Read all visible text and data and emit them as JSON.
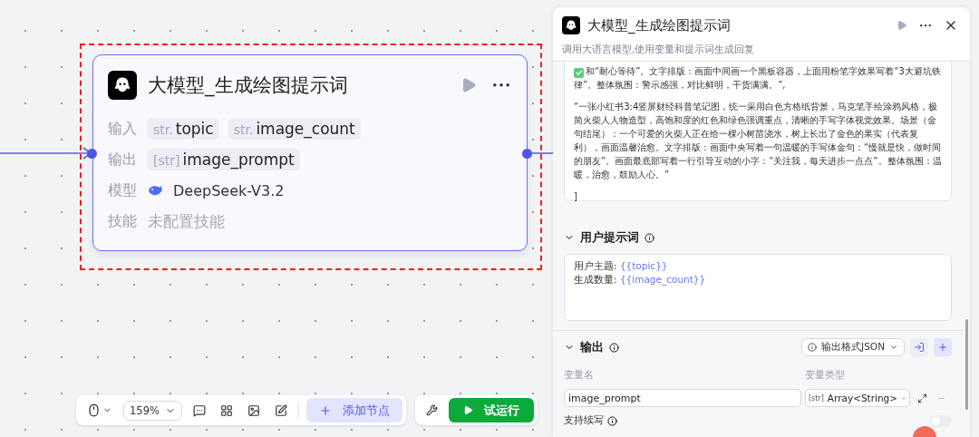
{
  "canvas": {
    "node": {
      "title": "大模型_生成绘图提示词",
      "highlighted": true,
      "rows": [
        {
          "label": "输入",
          "kind": "vars",
          "vars": [
            {
              "tag": "str.",
              "name": "topic"
            },
            {
              "tag": "str.",
              "name": "image_count"
            }
          ]
        },
        {
          "label": "输出",
          "kind": "vars",
          "vars": [
            {
              "tag": "[str]",
              "name": "image_prompt"
            }
          ]
        },
        {
          "label": "模型",
          "kind": "model",
          "value": "DeepSeek-V3.2"
        },
        {
          "label": "技能",
          "kind": "empty",
          "value": "未配置技能"
        }
      ]
    },
    "toolbar": {
      "zoom": "159%",
      "add_node": "添加节点",
      "run": "试运行"
    }
  },
  "panel": {
    "title": "大模型_生成绘图提示词",
    "subtitle": "调用大语言模型,使用变量和提示词生成回复",
    "system_prompt": [
      "和“耐心等待”。文字排版：画面中间画一个黑板容器，上面用粉笔字效果写着“3大避坑铁律”。整体氛围：警示感强，对比鲜明，干货满满。”,",
      "“一张小红书3:4竖屏财经科普笔记图，统一采用白色方格纸背景，马克笔手绘涂鸦风格，极简火柴人人物造型，高饱和度的红色和绿色强调重点，清晰的手写字体视觉效果。场景（金句结尾）：一个可爱的火柴人正在给一棵小树苗浇水，树上长出了金色的果实（代表复利），画面温馨治愈。文字排版：画面中央写着一句温暖的手写体金句：“慢就是快，做时间的朋友”。画面最底部写着一行引导互动的小字：“关注我，每天进步一点点”。整体氛围：温暖，治愈，鼓励人心。”",
      "]"
    ],
    "user_prompt": {
      "title": "用户提示词",
      "lines": [
        {
          "label": "用户主题: ",
          "var": "{{topic}}"
        },
        {
          "label": "生成数量: ",
          "var": "{{image_count}}"
        }
      ]
    },
    "output": {
      "title": "输出",
      "format": "输出格式JSON",
      "columns": [
        "变量名",
        "变量类型"
      ],
      "rows": [
        {
          "name": "image_prompt",
          "tag": "[str]",
          "type": "Array<String>"
        }
      ],
      "continue": {
        "label": "支持续写",
        "on": false
      }
    }
  }
}
